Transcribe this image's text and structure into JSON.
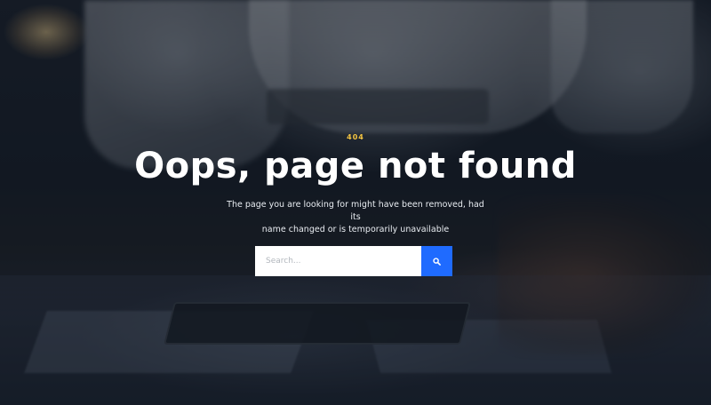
{
  "error": {
    "code": "404",
    "title": "Oops, page not found",
    "message_line1": "The page you are looking for might have been removed, had its",
    "message_line2": "name changed or is temporarily unavailable"
  },
  "search": {
    "placeholder": "Search...",
    "value": "",
    "button_icon": "search-icon"
  },
  "colors": {
    "accent_code": "#f5c542",
    "button": "#1f6bff",
    "title": "#ffffff"
  }
}
